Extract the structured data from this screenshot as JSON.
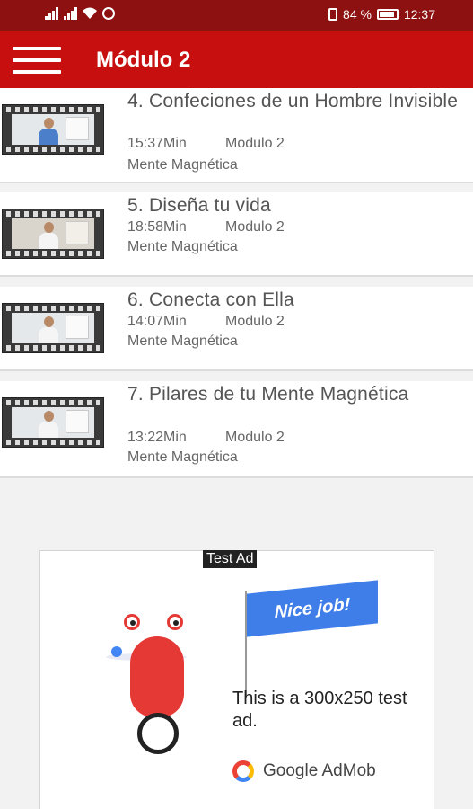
{
  "status_bar": {
    "battery": "84 %",
    "time": "12:37"
  },
  "app_bar": {
    "title": "Módulo 2",
    "menu_icon": "hamburger-menu-icon"
  },
  "videos": [
    {
      "title": "4. Confeciones de un Hombre Invisible",
      "duration": "15:37Min",
      "module": "Modulo 2",
      "course": "Mente Magnética"
    },
    {
      "title": "5. Diseña tu vida",
      "duration": "18:58Min",
      "module": "Modulo 2",
      "course": "Mente Magnética"
    },
    {
      "title": "6. Conecta con Ella",
      "duration": "14:07Min",
      "module": "Modulo 2",
      "course": "Mente Magnética"
    },
    {
      "title": "7. Pilares de tu  Mente Magnética",
      "duration": "13:22Min",
      "module": "Modulo 2",
      "course": "Mente Magnética"
    }
  ],
  "ad": {
    "label": "Test Ad",
    "flag_text": "Nice job!",
    "body": "This is a 300x250 test ad.",
    "brand": "Google AdMob"
  },
  "colors": {
    "status_bar": "#8d1111",
    "app_bar": "#c80f0f",
    "background": "#f2f2f2"
  }
}
